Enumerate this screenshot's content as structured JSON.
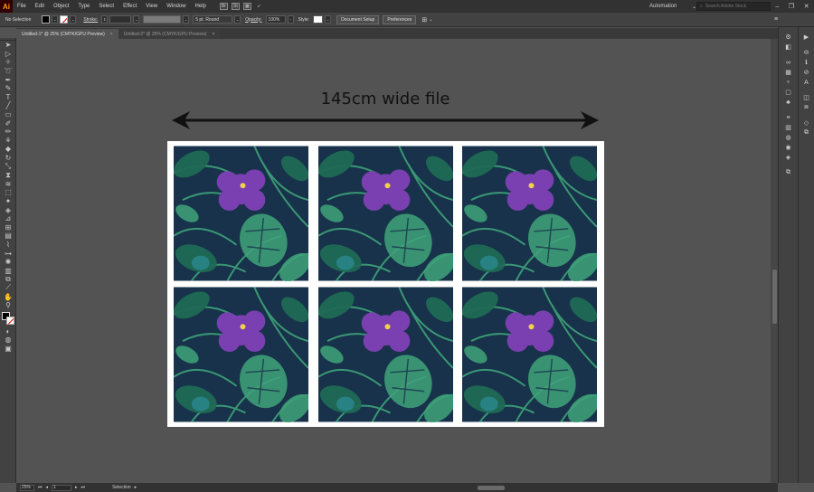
{
  "app": {
    "logo": "Ai",
    "menu": [
      "File",
      "Edit",
      "Object",
      "Type",
      "Select",
      "Effect",
      "View",
      "Window",
      "Help"
    ],
    "mb_icons": [
      "Br",
      "St"
    ],
    "workspace": "Automation",
    "search_placeholder": "Search Adobe Stock"
  },
  "control_bar": {
    "selection_label": "No Selection",
    "stroke_label": "Stroke:",
    "brush_label": "5 pt. Round",
    "opacity_label": "Opacity:",
    "opacity_value": "100%",
    "style_label": "Style:",
    "doc_setup": "Document Setup",
    "preferences": "Preferences"
  },
  "tabs": [
    {
      "label": "Untitled-1* @ 25% (CMYK/GPU Preview)",
      "close": "×"
    },
    {
      "label": "Untitled-2* @ 35% (CMYK/GPU Preview)",
      "close": "×"
    }
  ],
  "canvas": {
    "dimension_label": "145cm wide file"
  },
  "status_bar": {
    "zoom": "25%",
    "artboard_nav": "1",
    "tool": "Selection"
  },
  "colors": {
    "tile_background": "#17324a",
    "flower": "#7a3fb0",
    "leaf_light": "#3fa37a",
    "leaf_dark": "#1f6a55"
  }
}
